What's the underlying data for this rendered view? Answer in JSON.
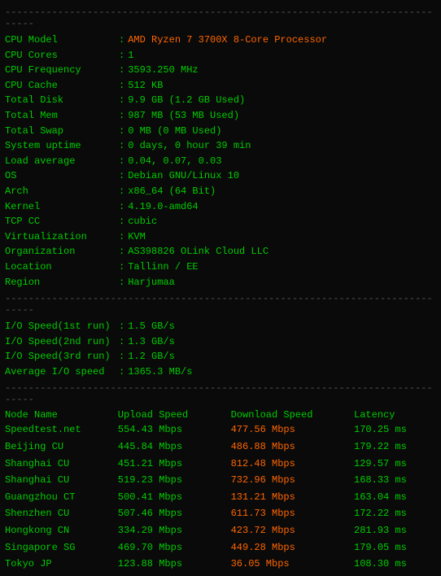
{
  "dividers": {
    "line": "------------------------------------------------------------------------------"
  },
  "sysinfo": {
    "rows": [
      {
        "label": "CPU Model",
        "value": "AMD Ryzen 7 3700X 8-Core Processor",
        "highlight": true
      },
      {
        "label": "CPU Cores",
        "value": "1",
        "highlight": false
      },
      {
        "label": "CPU Frequency",
        "value": "3593.250 MHz",
        "highlight": false
      },
      {
        "label": "CPU Cache",
        "value": "512 KB",
        "highlight": false
      },
      {
        "label": "Total Disk",
        "value": "9.9 GB (1.2 GB Used)",
        "highlight": false
      },
      {
        "label": "Total Mem",
        "value": "987 MB (53 MB Used)",
        "highlight": false
      },
      {
        "label": "Total Swap",
        "value": "0 MB (0 MB Used)",
        "highlight": false
      },
      {
        "label": "System uptime",
        "value": "0 days, 0 hour 39 min",
        "highlight": false
      },
      {
        "label": "Load average",
        "value": "0.04, 0.07, 0.03",
        "highlight": false
      },
      {
        "label": "OS",
        "value": "Debian GNU/Linux 10",
        "highlight": false
      },
      {
        "label": "Arch",
        "value": "x86_64 (64 Bit)",
        "highlight": false
      },
      {
        "label": "Kernel",
        "value": "4.19.0-amd64",
        "highlight": false
      },
      {
        "label": "TCP CC",
        "value": "cubic",
        "highlight": false
      },
      {
        "label": "Virtualization",
        "value": "KVM",
        "highlight": false
      },
      {
        "label": "Organization",
        "value": "AS398826 OLink Cloud LLC",
        "highlight": false
      },
      {
        "label": "Location",
        "value": "Tallinn / EE",
        "highlight": false
      },
      {
        "label": "Region",
        "value": "Harjumaa",
        "highlight": false
      }
    ]
  },
  "io": {
    "rows": [
      {
        "label": "I/O Speed(1st run)",
        "value": "1.5 GB/s"
      },
      {
        "label": "I/O Speed(2nd run)",
        "value": "1.3 GB/s"
      },
      {
        "label": "I/O Speed(3rd run)",
        "value": "1.2 GB/s"
      },
      {
        "label": "Average I/O speed",
        "value": "1365.3 MB/s"
      }
    ]
  },
  "nodes": {
    "headers": {
      "name": "Node Name",
      "upload": "Upload Speed",
      "download": "Download Speed",
      "latency": "Latency"
    },
    "rows": [
      {
        "name": "Speedtest.net",
        "cc": "",
        "upload": "554.43",
        "download": "477.56",
        "latency": "170.25"
      },
      {
        "name": "Beijing",
        "cc": "CU",
        "upload": "445.84",
        "download": "486.88",
        "latency": "179.22"
      },
      {
        "name": "Shanghai",
        "cc": "CU",
        "upload": "451.21",
        "download": "812.48",
        "latency": "129.57"
      },
      {
        "name": "Shanghai",
        "cc": "CU",
        "upload": "519.23",
        "download": "732.96",
        "latency": "168.33"
      },
      {
        "name": "Guangzhou",
        "cc": "CT",
        "upload": "500.41",
        "download": "131.21",
        "latency": "163.04"
      },
      {
        "name": "Shenzhen",
        "cc": "CU",
        "upload": "507.46",
        "download": "611.73",
        "latency": "172.22"
      },
      {
        "name": "Hongkong",
        "cc": "CN",
        "upload": "334.29",
        "download": "423.72",
        "latency": "281.93"
      },
      {
        "name": "Singapore",
        "cc": "SG",
        "upload": "469.70",
        "download": "449.28",
        "latency": "179.05"
      },
      {
        "name": "Tokyo",
        "cc": "JP",
        "upload": "123.88",
        "download": "36.05",
        "latency": "108.30"
      }
    ]
  }
}
